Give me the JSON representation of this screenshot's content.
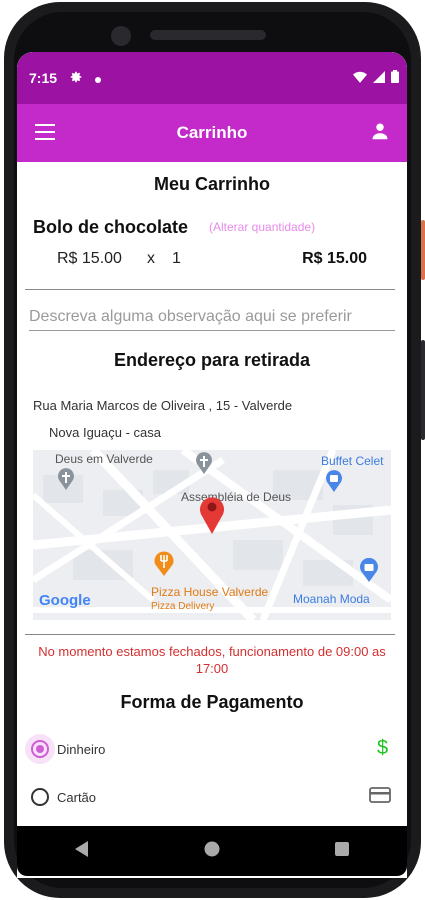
{
  "status_bar": {
    "time": "7:15"
  },
  "app_bar": {
    "title": "Carrinho"
  },
  "cart": {
    "title": "Meu Carrinho",
    "item": {
      "name": "Bolo de chocolate",
      "change_quantity_label": "(Alterar quantidade)",
      "unit_price": "R$ 15.00",
      "times": "x",
      "quantity": "1",
      "total": "R$ 15.00"
    },
    "observation_placeholder": "Descreva alguma observação aqui se preferir"
  },
  "pickup": {
    "title": "Endereço para retirada",
    "address_line1": "Rua Maria Marcos de Oliveira , 15 - Valverde",
    "address_line2": "Nova Iguaçu - casa",
    "map_labels": {
      "place1": "Deus em Valverde",
      "place2": "Assembléia de Deus",
      "place3": "Buffet Celet",
      "place4": "Pizza House Valverde",
      "place4_sub": "Pizza Delivery",
      "place5": "Moanah Moda",
      "google": "Google"
    }
  },
  "closed_message": "No momento estamos fechados, funcionamento de 09:00 as 17:00",
  "payment": {
    "title": "Forma de Pagamento",
    "options": [
      {
        "label": "Dinheiro",
        "selected": true,
        "icon": "cash-icon"
      },
      {
        "label": "Cartão",
        "selected": false,
        "icon": "card-icon"
      }
    ]
  },
  "colors": {
    "status_bar": "#9c13a3",
    "app_bar": "#c32ac9",
    "accent": "#d05cd6",
    "error": "#d32f2f",
    "cash_icon": "#1ec21e"
  }
}
